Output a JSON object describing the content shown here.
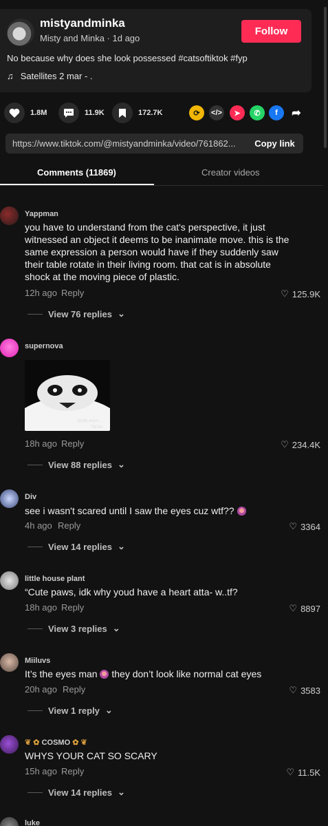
{
  "post": {
    "username": "mistyandminka",
    "display_name": "Misty and Minka",
    "age": "1d ago",
    "follow_label": "Follow",
    "description": "No because why does she look possessed #catsoftiktok #fyp",
    "music": "Satellites 2 mar - ."
  },
  "stats": {
    "likes": "1.8M",
    "comments": "11.9K",
    "saves": "172.7K"
  },
  "share_icons": [
    "repost-icon",
    "embed-icon",
    "send-icon",
    "whatsapp-icon",
    "facebook-icon",
    "share-arrow-icon"
  ],
  "link": {
    "url": "https://www.tiktok.com/@mistyandminka/video/761862...",
    "copy_label": "Copy link"
  },
  "tabs": {
    "comments": "Comments (11869)",
    "creator": "Creator videos"
  },
  "reply_label": "Reply",
  "comments": [
    {
      "name": "Yappman",
      "text": "you have to understand from the cat's perspective, it just witnessed an object it deems to be inanimate move. this is the same expression a person would have if they suddenly saw their table rotate in their living room. that cat is in absolute shock at the moving piece of plastic.",
      "time": "12h ago",
      "likes": "125.9K",
      "view_replies": "View 76 replies"
    },
    {
      "name": "supernova",
      "image_caption": "@idfk.anym...",
      "image_watermark": "TikTok",
      "time": "18h ago",
      "likes": "234.4K",
      "view_replies": "View 88 replies"
    },
    {
      "name": "Div",
      "text": "see i wasn't scared until I saw the eyes cuz wtf??",
      "time": "4h ago",
      "likes": "3364",
      "view_replies": "View 14 replies"
    },
    {
      "name": "little house plant",
      "text": "“Cute paws, idk why youd have a heart atta- w..tf?",
      "time": "18h ago",
      "likes": "8897",
      "view_replies": "View 3 replies"
    },
    {
      "name": "Miiluvs",
      "text_before": "It’s the eyes man",
      "text_after": "they don’t look like normal cat eyes",
      "time": "20h ago",
      "likes": "3583",
      "view_replies": "View 1 reply"
    },
    {
      "name": "COSMO",
      "text": "WHYS YOUR CAT SO SCARY",
      "time": "15h ago",
      "likes": "11.5K",
      "view_replies": "View 14 replies"
    },
    {
      "name": "luke"
    }
  ]
}
